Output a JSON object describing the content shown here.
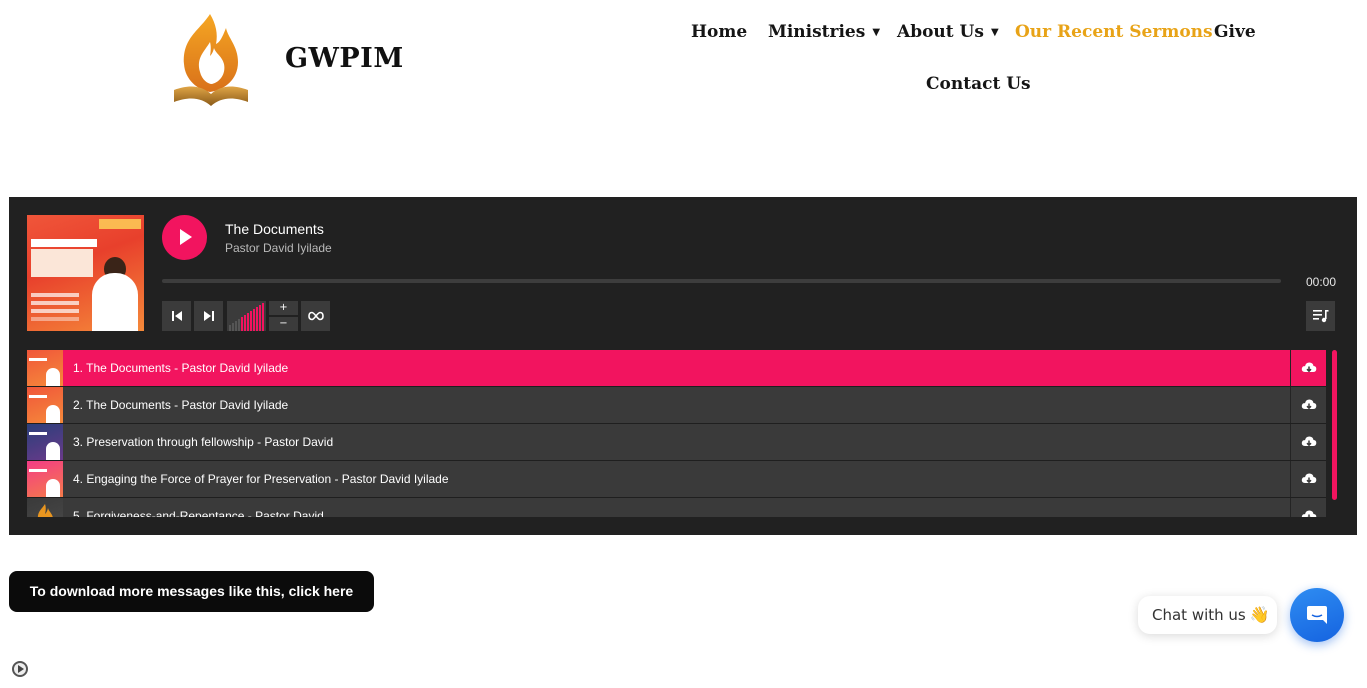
{
  "header": {
    "brand": "GWPIM",
    "logo_icon": "flame-bible-logo",
    "nav": {
      "home": "Home",
      "ministries": "Ministries",
      "about": "About Us",
      "sermons": "Our Recent Sermons",
      "give": "Give",
      "contact": "Contact Us"
    },
    "active_color": "#e8a317"
  },
  "player": {
    "current_title": "The Documents",
    "current_artist": "Pastor David Iyilade",
    "time": "00:00",
    "progress": 0,
    "accent_color": "#f2145f",
    "controls": {
      "prev_icon": "skip-previous-icon",
      "next_icon": "skip-next-icon",
      "volume_up": "+",
      "volume_down": "−",
      "repeat_icon": "infinity-icon",
      "playlist_icon": "playlist-icon"
    },
    "tracks": [
      {
        "label": "1. The Documents - Pastor David Iyilade",
        "active": true
      },
      {
        "label": "2. The Documents - Pastor David Iyilade",
        "active": false
      },
      {
        "label": "3. Preservation through fellowship - Pastor David",
        "active": false
      },
      {
        "label": "4. Engaging the Force of Prayer for Preservation - Pastor David Iyilade",
        "active": false
      },
      {
        "label": "5. Forgiveness-and-Repentance - Pastor David",
        "active": false
      }
    ]
  },
  "cta": {
    "download_label": "To download more messages like this, click here"
  },
  "chat": {
    "label": "Chat with us",
    "emoji": "👋"
  }
}
